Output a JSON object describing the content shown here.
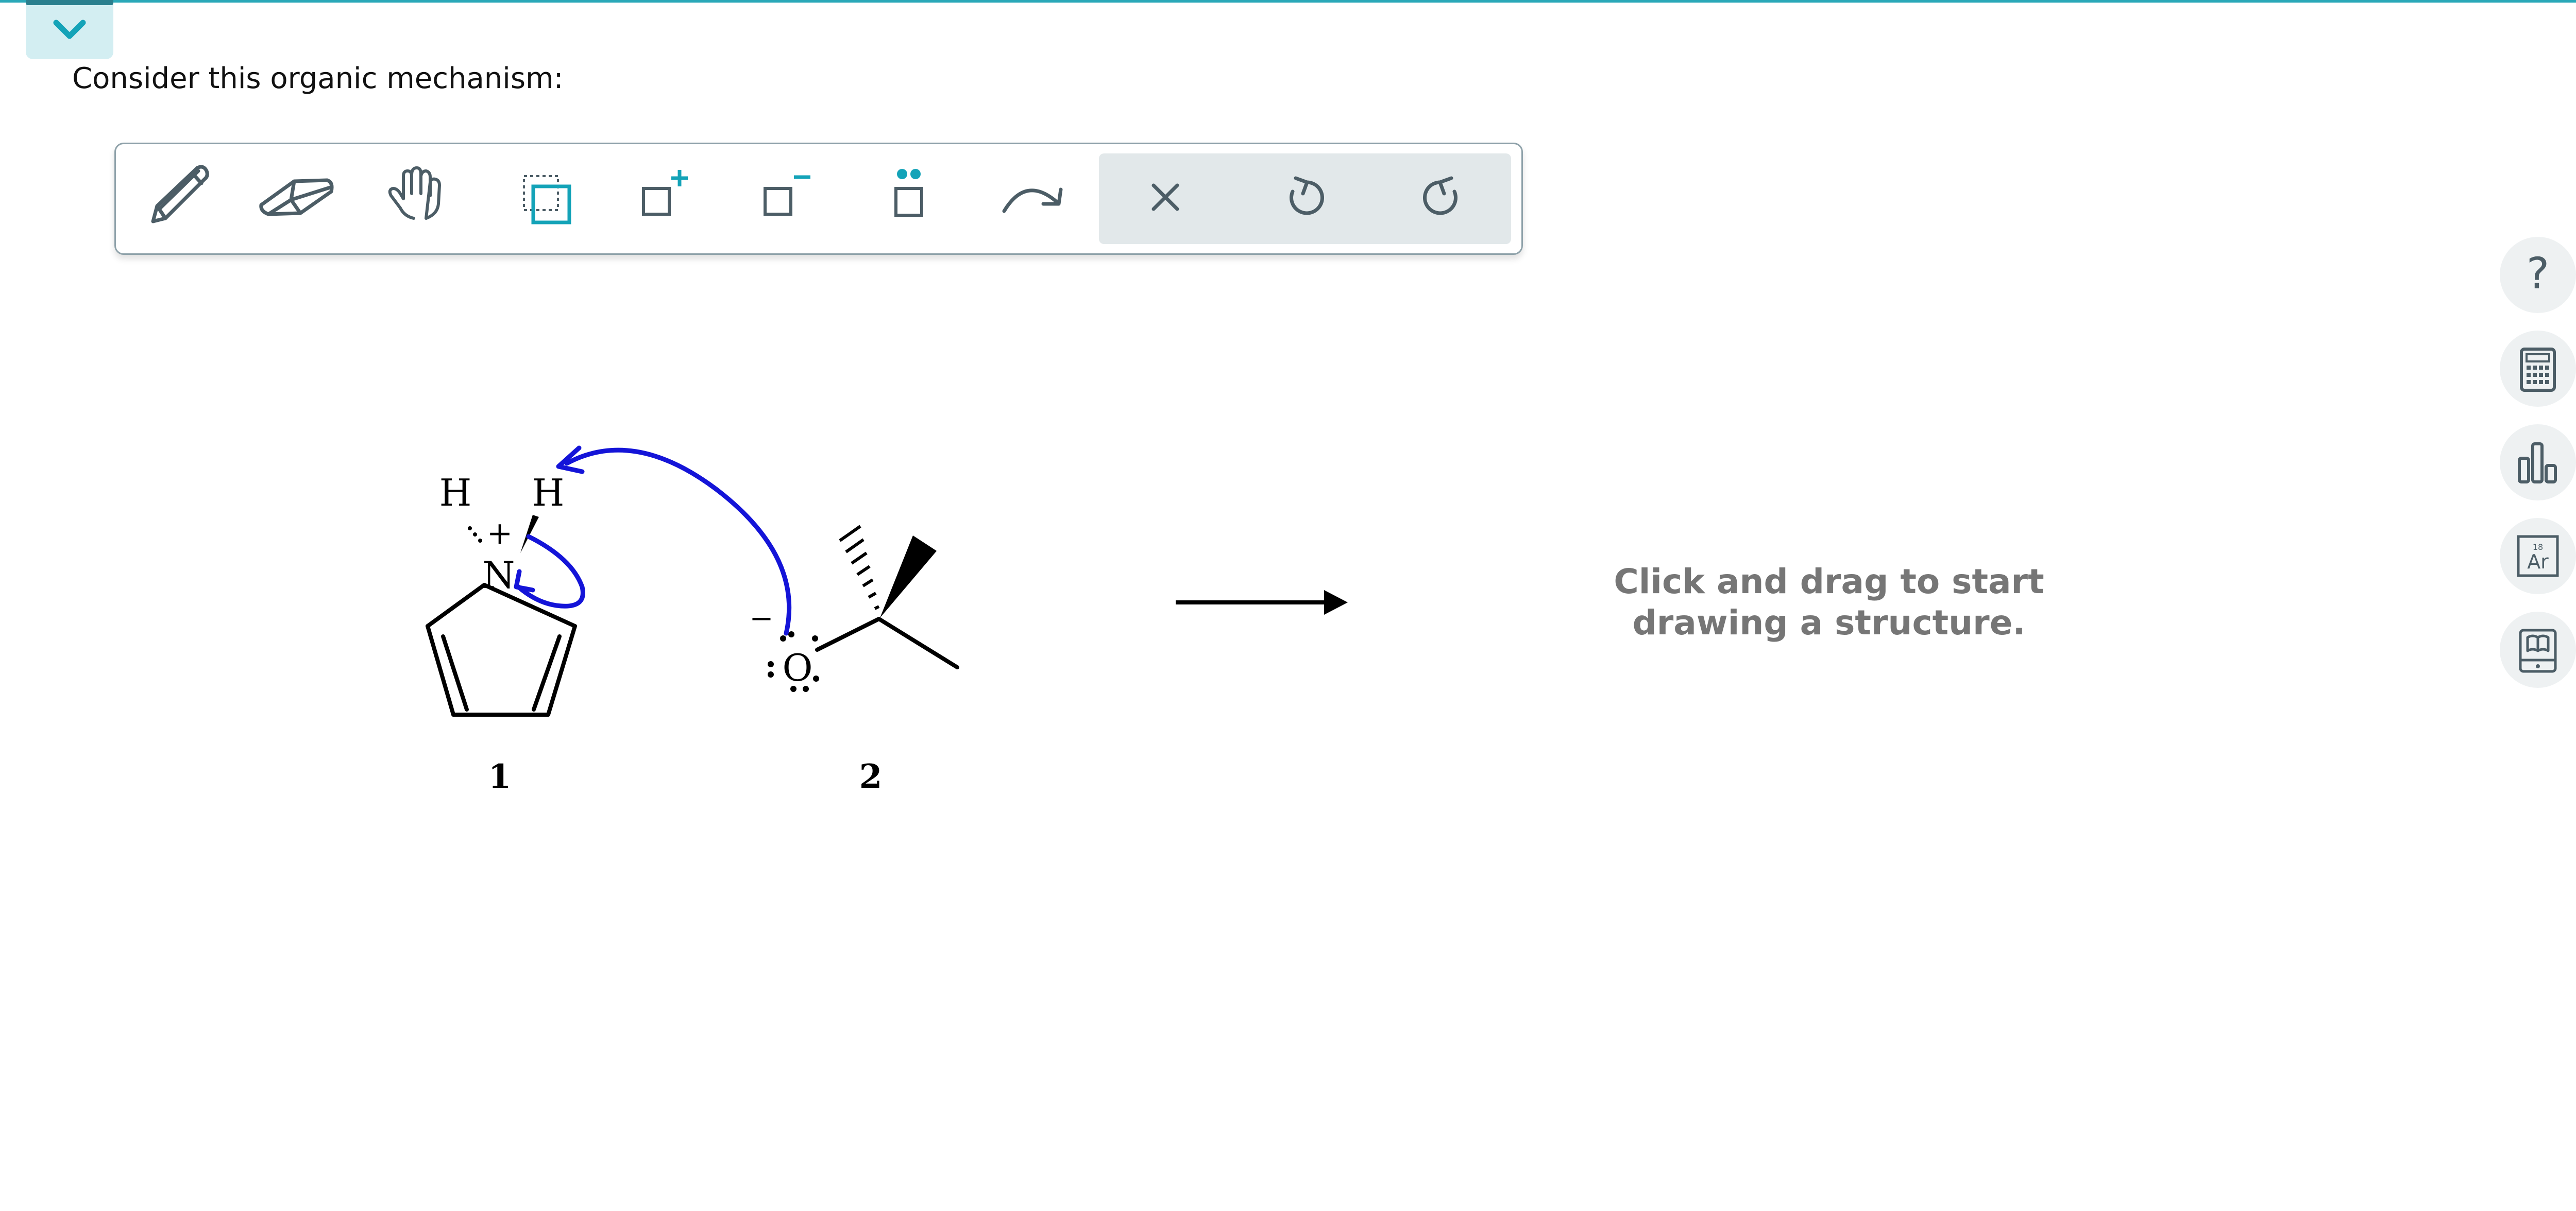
{
  "prompt": "Consider this organic mechanism:",
  "toolbar": {
    "tools": [
      {
        "name": "pencil-icon",
        "label": "Draw"
      },
      {
        "name": "eraser-icon",
        "label": "Erase"
      },
      {
        "name": "hand-icon",
        "label": "Move"
      },
      {
        "name": "select-box-icon",
        "label": "Select"
      },
      {
        "name": "add-charge-icon",
        "label": "Positive charge"
      },
      {
        "name": "remove-charge-icon",
        "label": "Negative charge"
      },
      {
        "name": "lone-pair-icon",
        "label": "Lone pair"
      },
      {
        "name": "curved-arrow-icon",
        "label": "Curved arrow"
      }
    ],
    "actions": [
      {
        "name": "clear-icon",
        "label": "Clear"
      },
      {
        "name": "undo-icon",
        "label": "Undo"
      },
      {
        "name": "redo-icon",
        "label": "Redo"
      }
    ]
  },
  "right_rail": {
    "help_glyph": "?",
    "element_box": {
      "number": "18",
      "symbol": "Ar"
    },
    "buttons": [
      "help-icon",
      "calculator-icon",
      "bar-chart-icon",
      "periodic-table-icon",
      "reference-book-icon"
    ]
  },
  "mechanism": {
    "compound1": {
      "label": "1",
      "atoms": {
        "h_left": "H",
        "h_right": "H",
        "n": "N",
        "charge": "+"
      }
    },
    "compound2": {
      "label": "2",
      "atoms": {
        "o": "O",
        "charge": "−"
      }
    }
  },
  "canvas_hint": {
    "line1": "Click and drag to start",
    "line2": "drawing a structure."
  },
  "colors": {
    "accent": "#2aa8b8",
    "arrow": "#1414d8",
    "hint": "#767676",
    "icon": "#4c5d66"
  }
}
